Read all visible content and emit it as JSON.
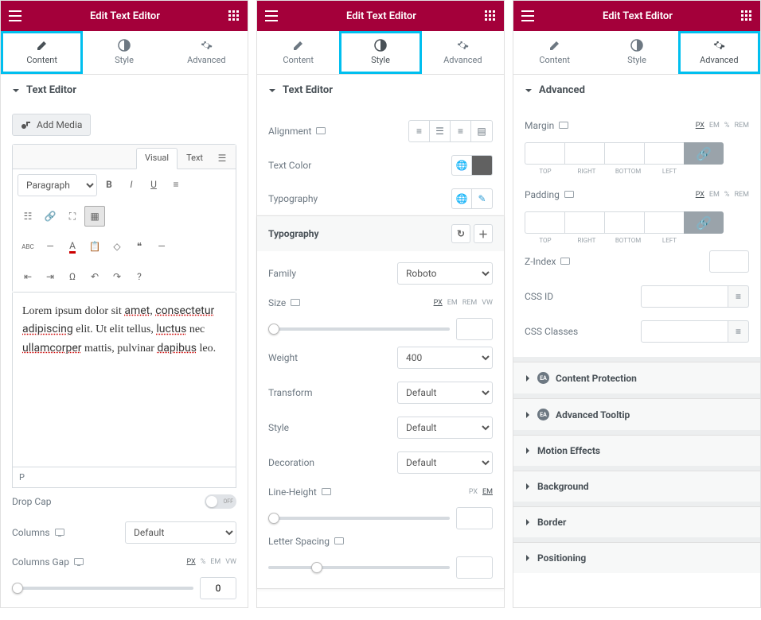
{
  "header": {
    "title": "Edit Text Editor"
  },
  "tabs": {
    "content": "Content",
    "style": "Style",
    "advanced": "Advanced"
  },
  "panel1": {
    "section_title": "Text Editor",
    "add_media": "Add Media",
    "editor_tabs": {
      "visual": "Visual",
      "text": "Text"
    },
    "paragraph_select": "Paragraph",
    "content_text": "Lorem ipsum dolor sit amet, consectetur adipiscing elit. Ut elit tellus, luctus nec ullamcorper mattis, pulvinar dapibus leo.",
    "status": "P",
    "drop_cap": {
      "label": "Drop Cap",
      "value": "OFF"
    },
    "columns": {
      "label": "Columns",
      "value": "Default"
    },
    "columns_gap": {
      "label": "Columns Gap",
      "value": "0",
      "units": [
        "PX",
        "%",
        "EM",
        "VW"
      ]
    }
  },
  "panel2": {
    "section_title": "Text Editor",
    "alignment": "Alignment",
    "text_color": "Text Color",
    "typography": "Typography",
    "popover_title": "Typography",
    "family": {
      "label": "Family",
      "value": "Roboto"
    },
    "size": {
      "label": "Size",
      "units": [
        "PX",
        "EM",
        "REM",
        "VW"
      ]
    },
    "weight": {
      "label": "Weight",
      "value": "400"
    },
    "transform": {
      "label": "Transform",
      "value": "Default"
    },
    "fstyle": {
      "label": "Style",
      "value": "Default"
    },
    "decoration": {
      "label": "Decoration",
      "value": "Default"
    },
    "line_height": {
      "label": "Line-Height",
      "units": [
        "PX",
        "EM"
      ]
    },
    "letter_spacing": {
      "label": "Letter Spacing"
    }
  },
  "panel3": {
    "section_title": "Advanced",
    "margin": {
      "label": "Margin",
      "units": [
        "PX",
        "EM",
        "%",
        "REM"
      ],
      "sides": [
        "TOP",
        "RIGHT",
        "BOTTOM",
        "LEFT"
      ]
    },
    "padding": {
      "label": "Padding",
      "units": [
        "PX",
        "EM",
        "%",
        "REM"
      ],
      "sides": [
        "TOP",
        "RIGHT",
        "BOTTOM",
        "LEFT"
      ]
    },
    "zindex": "Z-Index",
    "css_id": "CSS ID",
    "css_classes": "CSS Classes",
    "accordions": [
      "Content Protection",
      "Advanced Tooltip",
      "Motion Effects",
      "Background",
      "Border",
      "Positioning"
    ]
  }
}
